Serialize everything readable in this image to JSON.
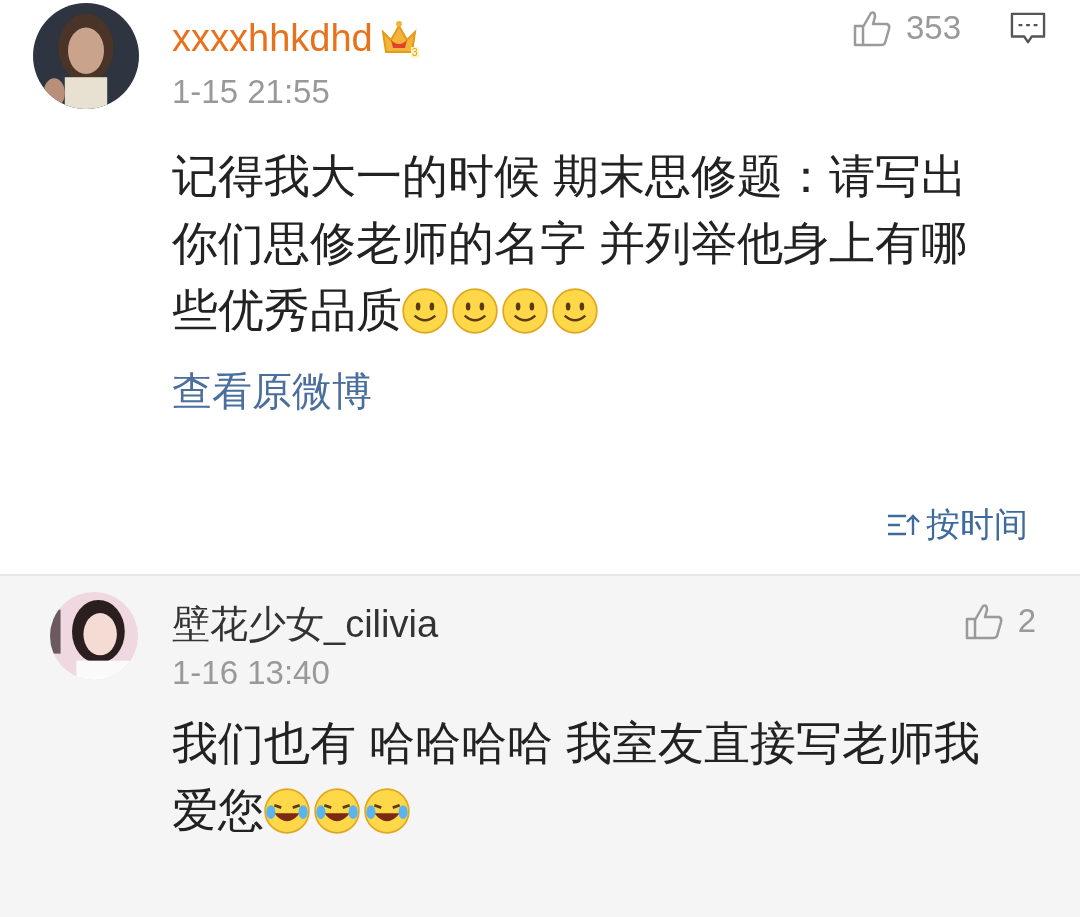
{
  "post": {
    "username": "xxxxhhkdhd",
    "badge_level": "3",
    "time": "1-15 21:55",
    "likes": "353",
    "content": "记得我大一的时候 期末思修题：请写出你们思修老师的名字 并列举他身上有哪些优秀品质",
    "emojis": [
      {
        "kind": "smile"
      },
      {
        "kind": "smile"
      },
      {
        "kind": "smile"
      },
      {
        "kind": "smile"
      }
    ],
    "view_original": "查看原微博",
    "sort_label": "按时间"
  },
  "comments": [
    {
      "username": "壁花少女_cilivia",
      "time": "1-16 13:40",
      "likes": "2",
      "content": "我们也有 哈哈哈哈 我室友直接写老师我爱您",
      "emojis": [
        {
          "kind": "laugh"
        },
        {
          "kind": "laugh"
        },
        {
          "kind": "laugh"
        }
      ]
    }
  ]
}
